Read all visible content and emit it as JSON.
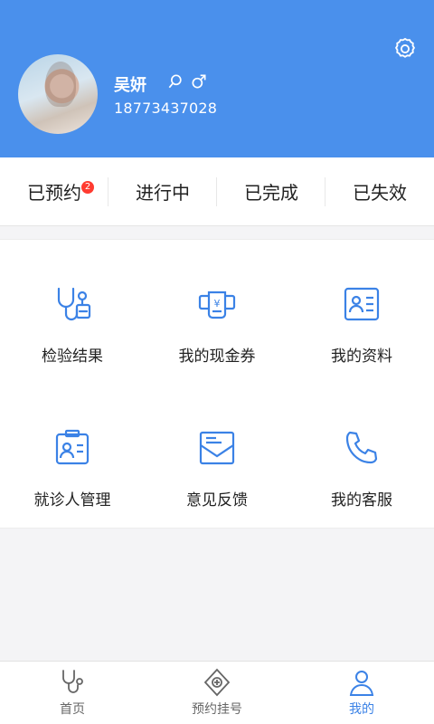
{
  "colors": {
    "brand": "#4a90ec",
    "active": "#3b82e6",
    "badge": "#ff3b30",
    "icon": "#3b82e6"
  },
  "profile": {
    "name": "吴妍",
    "phone": "18773437028",
    "icons": [
      "search-icon",
      "male-gender-icon"
    ]
  },
  "settings": {
    "icon": "gear-icon"
  },
  "orders": {
    "tabs": [
      {
        "label": "已预约",
        "badge": "2"
      },
      {
        "label": "进行中"
      },
      {
        "label": "已完成"
      },
      {
        "label": "已失效"
      }
    ]
  },
  "services": [
    {
      "label": "检验结果",
      "icon": "stethoscope-icon"
    },
    {
      "label": "我的现金券",
      "icon": "cash-coupon-icon"
    },
    {
      "label": "我的资料",
      "icon": "id-card-icon"
    },
    {
      "label": "就诊人管理",
      "icon": "patient-card-icon"
    },
    {
      "label": "意见反馈",
      "icon": "feedback-envelope-icon"
    },
    {
      "label": "我的客服",
      "icon": "phone-icon"
    }
  ],
  "tabbar": {
    "items": [
      {
        "label": "首页",
        "icon": "stethoscope-icon"
      },
      {
        "label": "预约挂号",
        "icon": "plus-diamond-icon"
      },
      {
        "label": "我的",
        "icon": "user-icon",
        "active": true
      }
    ]
  }
}
